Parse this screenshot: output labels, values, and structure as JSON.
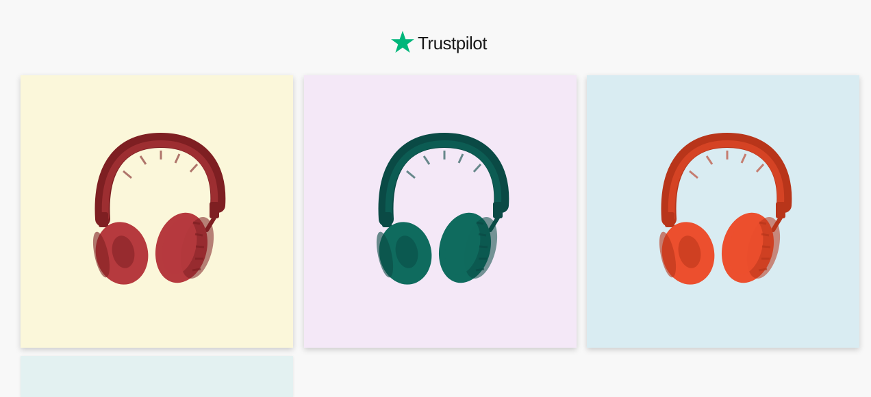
{
  "brand": {
    "name": "Trustpilot",
    "star_color": "#00b67a",
    "icon": "star-icon"
  },
  "cards": [
    {
      "background": "#fbf7da",
      "headphone_color": "#b63a3e",
      "headphone_dark": "#7e1f22",
      "icon": "headphones-icon"
    },
    {
      "background": "#f4e8f7",
      "headphone_color": "#0f6b5e",
      "headphone_dark": "#0a4a45",
      "icon": "headphones-icon"
    },
    {
      "background": "#d9ecf2",
      "headphone_color": "#ec4f2e",
      "headphone_dark": "#b8351a",
      "icon": "headphones-icon"
    },
    {
      "background": "#e3f1f1"
    }
  ]
}
